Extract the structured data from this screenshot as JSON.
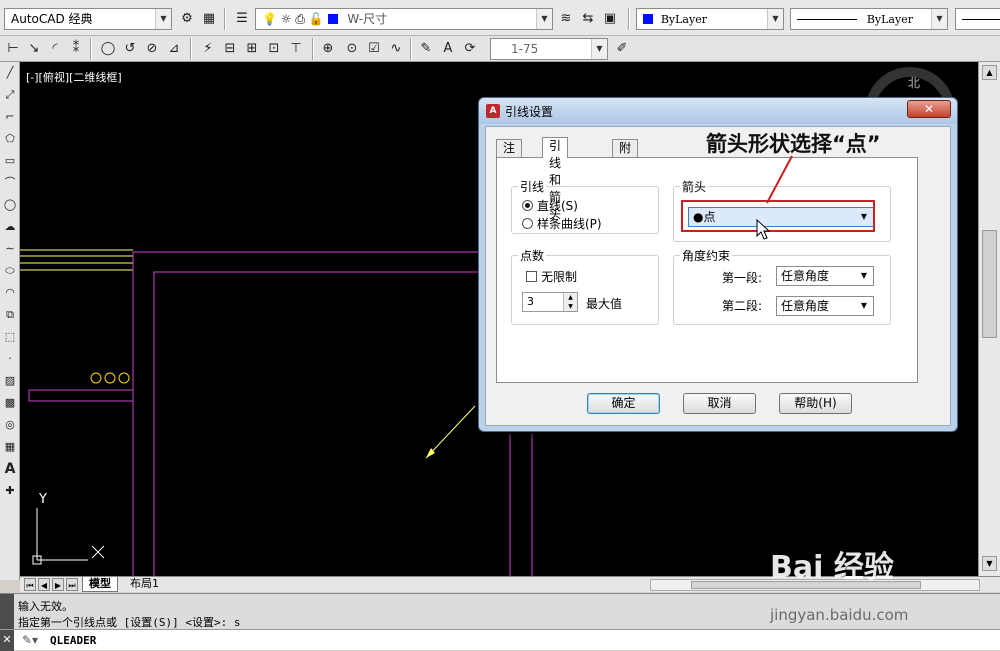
{
  "toolbar": {
    "workspace": "AutoCAD 经典",
    "layer": "W-尺寸",
    "color": "ByLayer",
    "linetype": "ByLayer",
    "dimstyle": "1-75"
  },
  "viewport": {
    "label": "[-][俯视][二维线框]",
    "compass": "北"
  },
  "ucs": {
    "y": "Y"
  },
  "tabs": {
    "model": "模型",
    "layout1": "布局1"
  },
  "command": {
    "history": [
      "输入无效。",
      "指定第一个引线点或 [设置(S)] <设置>: s"
    ],
    "current": "QLEADER"
  },
  "dialog": {
    "title": "引线设置",
    "tabs": [
      "注释",
      "引线和箭头",
      "附着"
    ],
    "leader_group": "引线",
    "leader_options": [
      "直线(S)",
      "样条曲线(P)"
    ],
    "points_group": "点数",
    "no_limit": "无限制",
    "points_value": "3",
    "max_label": "最大值",
    "arrow_group": "箭头",
    "arrow_value": "●点",
    "angle_group": "角度约束",
    "first_seg_label": "第一段:",
    "first_seg_value": "任意角度",
    "second_seg_label": "第二段:",
    "second_seg_value": "任意角度",
    "ok": "确定",
    "cancel": "取消",
    "help": "帮助(H)"
  },
  "annotation": "箭头形状选择“点”",
  "watermark": {
    "logo": "Bai 经验",
    "url": "jingyan.baidu.com"
  }
}
